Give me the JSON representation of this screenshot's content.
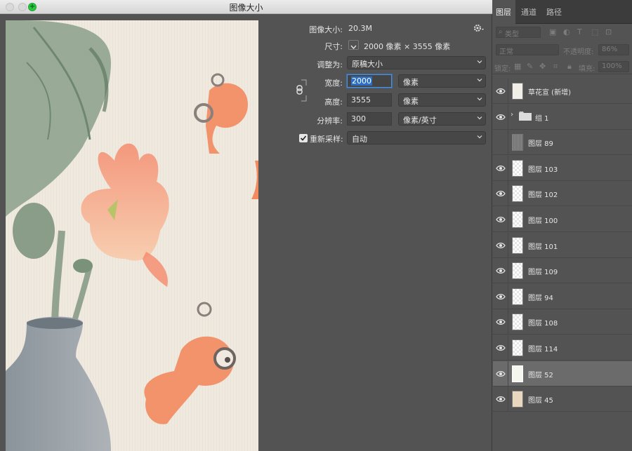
{
  "dialog": {
    "title": "图像大小",
    "image_size_label": "图像大小:",
    "image_size_value": "20.3M",
    "dimensions_label": "尺寸:",
    "dimensions_value": "2000 像素  ×  3555 像素",
    "fit_to_label": "调整为:",
    "fit_to_value": "原稿大小",
    "width_label": "宽度:",
    "width_value": "2000",
    "width_unit": "像素",
    "height_label": "高度:",
    "height_value": "3555",
    "height_unit": "像素",
    "resolution_label": "分辨率:",
    "resolution_value": "300",
    "resolution_unit": "像素/英寸",
    "resample_label": "重新采样:",
    "resample_checked": true,
    "resample_value": "自动"
  },
  "layers_panel": {
    "tabs": [
      "图层",
      "通道",
      "路径"
    ],
    "active_tab": "图层",
    "filter_kind": "类型",
    "blend_mode": "正常",
    "opacity_label": "不透明度:",
    "opacity_value": "86%",
    "lock_label": "锁定:",
    "fill_label": "填充:",
    "fill_value": "100%",
    "layers": [
      {
        "name": "草花宣 (新增)",
        "visible": true,
        "thumb": "paper"
      },
      {
        "name": "组 1",
        "visible": true,
        "thumb": "folder"
      },
      {
        "name": "图层 89",
        "visible": false,
        "thumb": "texture"
      },
      {
        "name": "图层 103",
        "visible": true,
        "thumb": "transparent"
      },
      {
        "name": "图层 102",
        "visible": true,
        "thumb": "transparent"
      },
      {
        "name": "图层 100",
        "visible": true,
        "thumb": "transparent"
      },
      {
        "name": "图层 101",
        "visible": true,
        "thumb": "transparent"
      },
      {
        "name": "图层 109",
        "visible": true,
        "thumb": "transparent"
      },
      {
        "name": "图层 94",
        "visible": true,
        "thumb": "transparent"
      },
      {
        "name": "图层 108",
        "visible": true,
        "thumb": "transparent"
      },
      {
        "name": "图层 114",
        "visible": true,
        "thumb": "transparent"
      },
      {
        "name": "图层 52",
        "visible": true,
        "thumb": "light",
        "selected": true
      },
      {
        "name": "图层 45",
        "visible": true,
        "thumb": "beige"
      }
    ]
  },
  "colors": {
    "panel_bg": "#535353",
    "selection_blue": "#2d6fc7",
    "zoom_green": "#28c840"
  }
}
